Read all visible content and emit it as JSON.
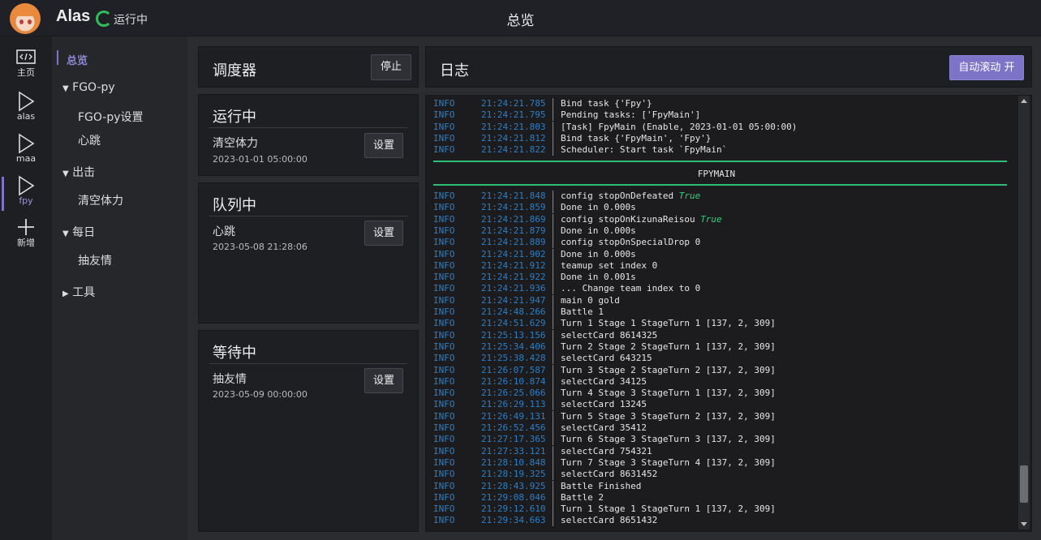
{
  "header": {
    "app_name": "Alas",
    "status": "运行中",
    "title": "总览"
  },
  "icon_nav": [
    {
      "label": "主页",
      "icon": "code-icon"
    },
    {
      "label": "alas",
      "icon": "play-icon"
    },
    {
      "label": "maa",
      "icon": "play-icon"
    },
    {
      "label": "fpy",
      "icon": "play-icon",
      "active": true
    },
    {
      "label": "新增",
      "icon": "plus-icon"
    }
  ],
  "menu": {
    "overview": "总览",
    "groups": [
      {
        "label": "FGO-py",
        "expanded": true,
        "items": [
          "FGO-py设置",
          "心跳"
        ]
      },
      {
        "label": "出击",
        "expanded": true,
        "items": [
          "清空体力"
        ]
      },
      {
        "label": "每日",
        "expanded": true,
        "items": [
          "抽友情"
        ]
      },
      {
        "label": "工具",
        "expanded": false,
        "items": []
      }
    ]
  },
  "scheduler": {
    "title": "调度器",
    "stop_label": "停止"
  },
  "running": {
    "title": "运行中",
    "task": "清空体力",
    "time": "2023-01-01 05:00:00",
    "button": "设置"
  },
  "queued": {
    "title": "队列中",
    "task": "心跳",
    "time": "2023-05-08 21:28:06",
    "button": "设置"
  },
  "waiting": {
    "title": "等待中",
    "task": "抽友情",
    "time": "2023-05-09 00:00:00",
    "button": "设置"
  },
  "log": {
    "title": "日志",
    "autoscroll_label": "自动滚动 开",
    "section": "FPYMAIN",
    "lines_before": [
      {
        "level": "INFO",
        "time": "21:24:21.785",
        "msg": "Bind task {'Fpy'}"
      },
      {
        "level": "INFO",
        "time": "21:24:21.795",
        "msg": "Pending tasks: ['FpyMain']"
      },
      {
        "level": "INFO",
        "time": "21:24:21.803",
        "msg": "[Task] FpyMain (Enable, 2023-01-01 05:00:00)"
      },
      {
        "level": "INFO",
        "time": "21:24:21.812",
        "msg": "Bind task {'FpyMain', 'Fpy'}"
      },
      {
        "level": "INFO",
        "time": "21:24:21.822",
        "msg": "Scheduler: Start task `FpyMain`"
      }
    ],
    "lines_after": [
      {
        "level": "INFO",
        "time": "21:24:21.848",
        "msg": "config stopOnDefeated ",
        "hl": "True"
      },
      {
        "level": "INFO",
        "time": "21:24:21.859",
        "msg": "Done in 0.000s"
      },
      {
        "level": "INFO",
        "time": "21:24:21.869",
        "msg": "config stopOnKizunaReisou ",
        "hl": "True"
      },
      {
        "level": "INFO",
        "time": "21:24:21.879",
        "msg": "Done in 0.000s"
      },
      {
        "level": "INFO",
        "time": "21:24:21.889",
        "msg": "config stopOnSpecialDrop 0"
      },
      {
        "level": "INFO",
        "time": "21:24:21.902",
        "msg": "Done in 0.000s"
      },
      {
        "level": "INFO",
        "time": "21:24:21.912",
        "msg": "teamup set index 0"
      },
      {
        "level": "INFO",
        "time": "21:24:21.922",
        "msg": "Done in 0.001s"
      },
      {
        "level": "INFO",
        "time": "21:24:21.936",
        "msg": "... Change team index to 0"
      },
      {
        "level": "INFO",
        "time": "21:24:21.947",
        "msg": "main 0 gold"
      },
      {
        "level": "INFO",
        "time": "21:24:48.266",
        "msg": "Battle 1"
      },
      {
        "level": "INFO",
        "time": "21:24:51.629",
        "msg": "Turn 1 Stage 1 StageTurn 1 [137, 2, 309]"
      },
      {
        "level": "INFO",
        "time": "21:25:13.156",
        "msg": "selectCard 8614325"
      },
      {
        "level": "INFO",
        "time": "21:25:34.406",
        "msg": "Turn 2 Stage 2 StageTurn 1 [137, 2, 309]"
      },
      {
        "level": "INFO",
        "time": "21:25:38.428",
        "msg": "selectCard 643215"
      },
      {
        "level": "INFO",
        "time": "21:26:07.587",
        "msg": "Turn 3 Stage 2 StageTurn 2 [137, 2, 309]"
      },
      {
        "level": "INFO",
        "time": "21:26:10.874",
        "msg": "selectCard 34125"
      },
      {
        "level": "INFO",
        "time": "21:26:25.066",
        "msg": "Turn 4 Stage 3 StageTurn 1 [137, 2, 309]"
      },
      {
        "level": "INFO",
        "time": "21:26:29.113",
        "msg": "selectCard 13245"
      },
      {
        "level": "INFO",
        "time": "21:26:49.131",
        "msg": "Turn 5 Stage 3 StageTurn 2 [137, 2, 309]"
      },
      {
        "level": "INFO",
        "time": "21:26:52.456",
        "msg": "selectCard 35412"
      },
      {
        "level": "INFO",
        "time": "21:27:17.365",
        "msg": "Turn 6 Stage 3 StageTurn 3 [137, 2, 309]"
      },
      {
        "level": "INFO",
        "time": "21:27:33.121",
        "msg": "selectCard 754321"
      },
      {
        "level": "INFO",
        "time": "21:28:10.848",
        "msg": "Turn 7 Stage 3 StageTurn 4 [137, 2, 309]"
      },
      {
        "level": "INFO",
        "time": "21:28:19.325",
        "msg": "selectCard 8631452"
      },
      {
        "level": "INFO",
        "time": "21:28:43.925",
        "msg": "Battle Finished"
      },
      {
        "level": "INFO",
        "time": "21:29:08.046",
        "msg": "Battle 2"
      },
      {
        "level": "INFO",
        "time": "21:29:12.610",
        "msg": "Turn 1 Stage 1 StageTurn 1 [137, 2, 309]"
      },
      {
        "level": "INFO",
        "time": "21:29:34.663",
        "msg": "selectCard 8651432"
      }
    ]
  },
  "colors": {
    "accent": "#7d74c8",
    "log_level": "#2b7fc6",
    "section_line": "#2dbf7a",
    "running": "#2fbf5a"
  }
}
